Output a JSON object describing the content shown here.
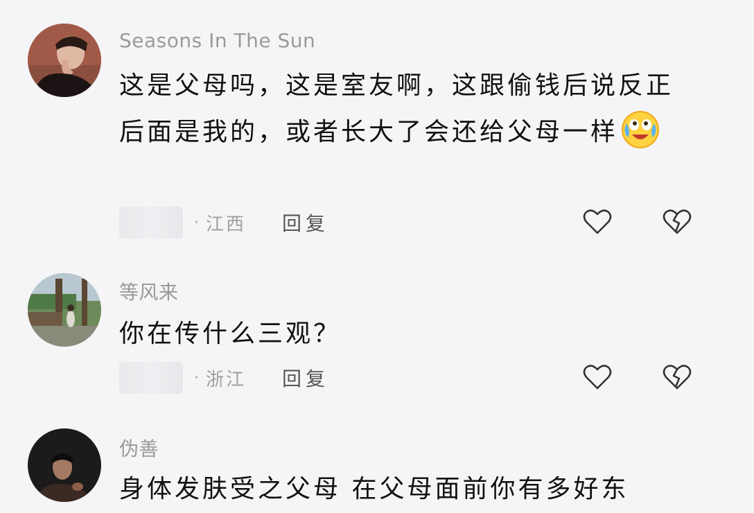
{
  "comments": [
    {
      "username": "Seasons In The Sun",
      "avatar": "avatar-person-hand-on-face",
      "text": "这是父母吗，这是室友啊，这跟偷钱后说反正后面是我的，或者长大了会还给父母一样",
      "emoji": "laughing-crying-emoji",
      "location": "江西",
      "reply_label": "回复",
      "like_icon": "heart-outline-icon",
      "dislike_icon": "broken-heart-icon"
    },
    {
      "username": "等风来",
      "avatar": "avatar-outdoor-pavilion-photo",
      "text": "你在传什么三观？",
      "location": "浙江",
      "reply_label": "回复",
      "like_icon": "heart-outline-icon",
      "dislike_icon": "broken-heart-icon"
    },
    {
      "username": "伪善",
      "avatar": "avatar-dark-portrait",
      "text": "身体发肤受之父母 在父母面前你有多好东"
    }
  ],
  "meta_separator": "·",
  "colors": {
    "background": "#f5f5f7",
    "username": "#9a9a9a",
    "text": "#111111",
    "meta": "#a0a0a0"
  }
}
